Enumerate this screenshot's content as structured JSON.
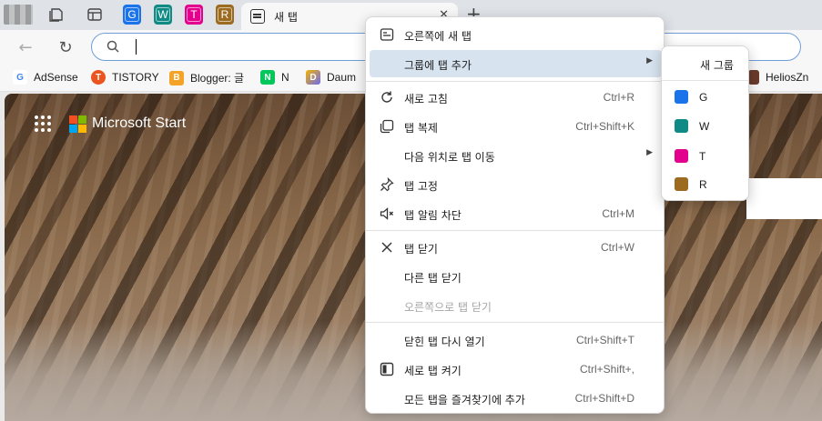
{
  "tabstrip": {
    "groups": [
      {
        "label": "G",
        "color": "#1a73e8"
      },
      {
        "label": "W",
        "color": "#0f8a84"
      },
      {
        "label": "T",
        "color": "#e3008c"
      },
      {
        "label": "R",
        "color": "#9c6b1f"
      }
    ],
    "active_tab_title": "새 탭",
    "close_glyph": "✕",
    "new_tab_glyph": "+"
  },
  "toolbar": {
    "back_glyph": "←",
    "refresh_glyph": "↻",
    "address_value": ""
  },
  "favorites": [
    {
      "label": "AdSense",
      "icon": "google-icon",
      "color": "#ffffff",
      "glyph": "G"
    },
    {
      "label": "TISTORY",
      "icon": "tistory-icon",
      "color": "#eb531f",
      "glyph": "T"
    },
    {
      "label": "Blogger: 글",
      "icon": "blogger-icon",
      "color": "#f4a327",
      "glyph": "B"
    },
    {
      "label": "N",
      "icon": "naver-icon",
      "color": "#03c75a",
      "glyph": "N"
    },
    {
      "label": "Daum",
      "icon": "daum-icon",
      "color": "#6b6bf0",
      "glyph": "D"
    },
    {
      "label": "HeliosZn",
      "icon": "helios-icon",
      "color": "#6a3b2b",
      "glyph": ""
    }
  ],
  "content": {
    "brand": "Microsoft Start"
  },
  "context_menu": {
    "items": [
      {
        "label": "오른쪽에 새 탭",
        "shortcut": "",
        "icon": "new-tab-right-icon"
      },
      {
        "label": "그룹에 탭 추가",
        "shortcut": "",
        "icon": "",
        "submenu": true,
        "highlighted": true
      },
      {
        "label": "새로 고침",
        "shortcut": "Ctrl+R",
        "icon": "refresh-icon"
      },
      {
        "label": "탭 복제",
        "shortcut": "Ctrl+Shift+K",
        "icon": "duplicate-icon"
      },
      {
        "label": "다음 위치로 탭 이동",
        "shortcut": "",
        "icon": "",
        "submenu": true
      },
      {
        "label": "탭 고정",
        "shortcut": "",
        "icon": "pin-icon"
      },
      {
        "label": "탭 알림 차단",
        "shortcut": "Ctrl+M",
        "icon": "mute-icon"
      },
      {
        "label": "탭 닫기",
        "shortcut": "Ctrl+W",
        "icon": "close-icon"
      },
      {
        "label": "다른 탭 닫기",
        "shortcut": "",
        "icon": ""
      },
      {
        "label": "오른쪽으로 탭 닫기",
        "shortcut": "",
        "icon": "",
        "disabled": true
      },
      {
        "label": "닫힌 탭 다시 열기",
        "shortcut": "Ctrl+Shift+T",
        "icon": ""
      },
      {
        "label": "세로 탭 켜기",
        "shortcut": "Ctrl+Shift+,",
        "icon": "vertical-tabs-icon"
      },
      {
        "label": "모든 탭을 즐겨찾기에 추가",
        "shortcut": "Ctrl+Shift+D",
        "icon": ""
      }
    ],
    "submenu_arrow": "▶"
  },
  "group_submenu": {
    "header": "새 그룹",
    "groups": [
      {
        "label": "G",
        "color": "#1a73e8"
      },
      {
        "label": "W",
        "color": "#0f8a84"
      },
      {
        "label": "T",
        "color": "#e3008c"
      },
      {
        "label": "R",
        "color": "#9c6b1f"
      }
    ]
  }
}
